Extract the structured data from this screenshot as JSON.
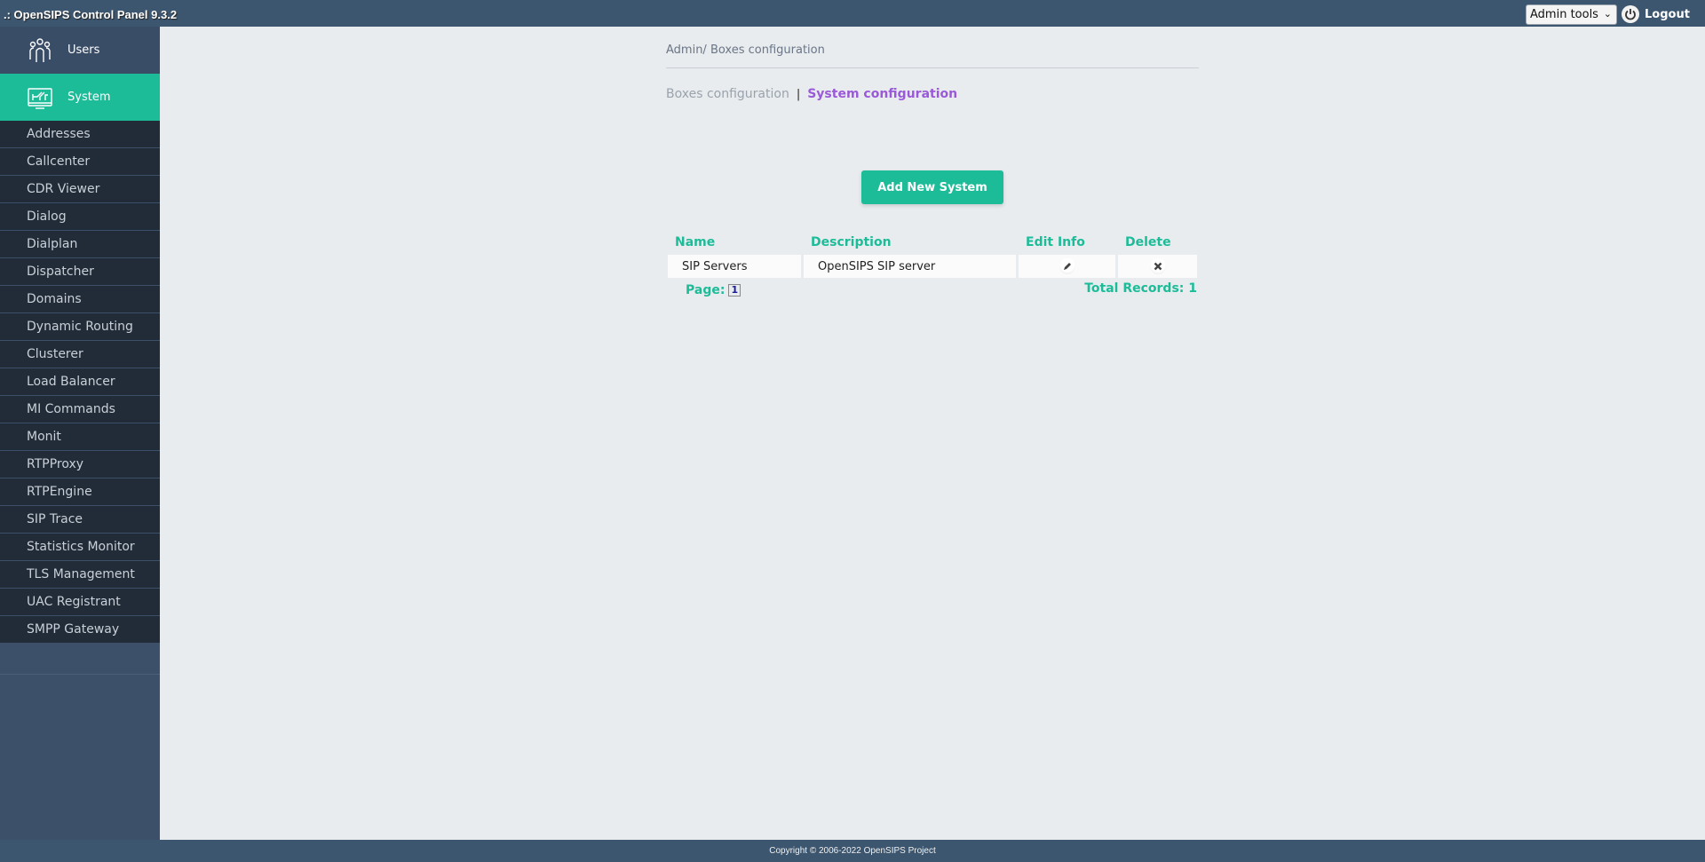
{
  "app": {
    "title": ".: OpenSIPS Control Panel 9.3.2"
  },
  "topbar": {
    "admin_select": {
      "selected": "Admin tools"
    },
    "power_icon": "power-icon",
    "logout_label": "Logout"
  },
  "sidebar": {
    "main_items": [
      {
        "label": "Users",
        "icon": "users-icon",
        "active": false
      },
      {
        "label": "System",
        "icon": "system-icon",
        "active": true
      }
    ],
    "sub_items": [
      {
        "label": "Addresses"
      },
      {
        "label": "Callcenter"
      },
      {
        "label": "CDR Viewer"
      },
      {
        "label": "Dialog"
      },
      {
        "label": "Dialplan"
      },
      {
        "label": "Dispatcher"
      },
      {
        "label": "Domains"
      },
      {
        "label": "Dynamic Routing"
      },
      {
        "label": "Clusterer"
      },
      {
        "label": "Load Balancer"
      },
      {
        "label": "MI Commands"
      },
      {
        "label": "Monit"
      },
      {
        "label": "RTPProxy"
      },
      {
        "label": "RTPEngine"
      },
      {
        "label": "SIP Trace"
      },
      {
        "label": "Statistics Monitor"
      },
      {
        "label": "TLS Management"
      },
      {
        "label": "UAC Registrant"
      },
      {
        "label": "SMPP Gateway"
      }
    ]
  },
  "main": {
    "breadcrumb": "Admin/ Boxes configuration",
    "subnav": {
      "inactive": "Boxes configuration",
      "separator": "|",
      "active": "System configuration"
    },
    "add_button": "Add New System",
    "table": {
      "headers": [
        "Name",
        "Description",
        "Edit Info",
        "Delete"
      ],
      "rows": [
        {
          "name": "SIP Servers",
          "description": "OpenSIPS SIP server",
          "edit_icon": "pencil-icon",
          "delete_icon": "x-icon"
        }
      ],
      "page_label": "Page:",
      "page_number": "1",
      "total_records": "Total Records: 1"
    }
  },
  "footer": {
    "copyright": "Copyright © 2006-2022 OpenSIPS Project"
  },
  "colors": {
    "accent": "#1dbc98",
    "active_subnav": "#9b59d9",
    "topbar": "#3c566f",
    "sidebar_dark": "#222b38"
  }
}
